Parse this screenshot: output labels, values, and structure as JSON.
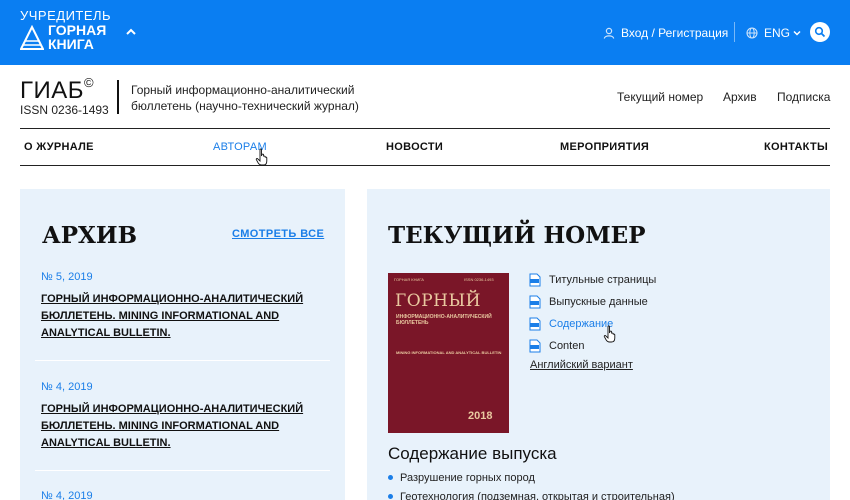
{
  "topbar": {
    "founder_label": "УЧРЕДИТЕЛЬ",
    "publisher_line1": "ГОРНАЯ",
    "publisher_line2": "КНИГА",
    "auth_label": "Вход / Регистрация",
    "lang_label": "ENG",
    "colors": {
      "bar": "#0a7ef2",
      "text": "#ffffff"
    }
  },
  "journal": {
    "abbr": "ГИАБ",
    "copyright": "©",
    "issn": "ISSN 0236-1493",
    "description": "Горный информационно-аналитический бюллетень (научно-технический журнал)"
  },
  "header_links": [
    "Текущий номер",
    "Архив",
    "Подписка"
  ],
  "nav": {
    "items": [
      {
        "label": "О ЖУРНАЛЕ",
        "active": false
      },
      {
        "label": "АВТОРАМ",
        "active": true
      },
      {
        "label": "НОВОСТИ",
        "active": false
      },
      {
        "label": "МЕРОПРИЯТИЯ",
        "active": false
      },
      {
        "label": "КОНТАКТЫ",
        "active": false
      }
    ],
    "accent": "#1a7ee8"
  },
  "archive": {
    "title": "АРХИВ",
    "see_all": "СМОТРЕТЬ ВСЕ",
    "issues": [
      {
        "number": "№ 5, 2019",
        "title": "ГОРНЫЙ ИНФОРМАЦИОННО-АНАЛИТИЧЕСКИЙ БЮЛЛЕТЕНЬ. MINING INFORMATIONAL AND ANALYTICAL BULLETIN."
      },
      {
        "number": "№ 4, 2019",
        "title": "ГОРНЫЙ ИНФОРМАЦИОННО-АНАЛИТИЧЕСКИЙ БЮЛЛЕТЕНЬ. MINING INFORMATIONAL AND ANALYTICAL BULLETIN."
      },
      {
        "number": "№ 4, 2019",
        "title": ""
      }
    ]
  },
  "current": {
    "title": "ТЕКУЩИЙ НОМЕР",
    "cover": {
      "top_left": "ГОРНАЯ КНИГА",
      "top_right": "ISSN 0236-1493",
      "big": "ГОРНЫЙ",
      "subtitle": "ИНФОРМАЦИОННО-АНАЛИТИЧЕСКИЙ БЮЛЛЕТЕНЬ",
      "subtitle_en": "MINING INFORMATIONAL AND ANALYTICAL BULLETIN",
      "year": "2018",
      "color": "#7a1628"
    },
    "docs": [
      {
        "label": "Титульные страницы",
        "hover": false
      },
      {
        "label": "Выпускные данные",
        "hover": false
      },
      {
        "label": "Содержание",
        "hover": true
      },
      {
        "label": "Conten",
        "hover": false
      }
    ],
    "en_version": "Английский вариант",
    "contents_title": "Содержание выпуска",
    "contents": [
      "Разрушение горных пород",
      "Геотехнология (подземная, открытая и строительная)"
    ]
  },
  "card_bg": "#e8f2fb"
}
